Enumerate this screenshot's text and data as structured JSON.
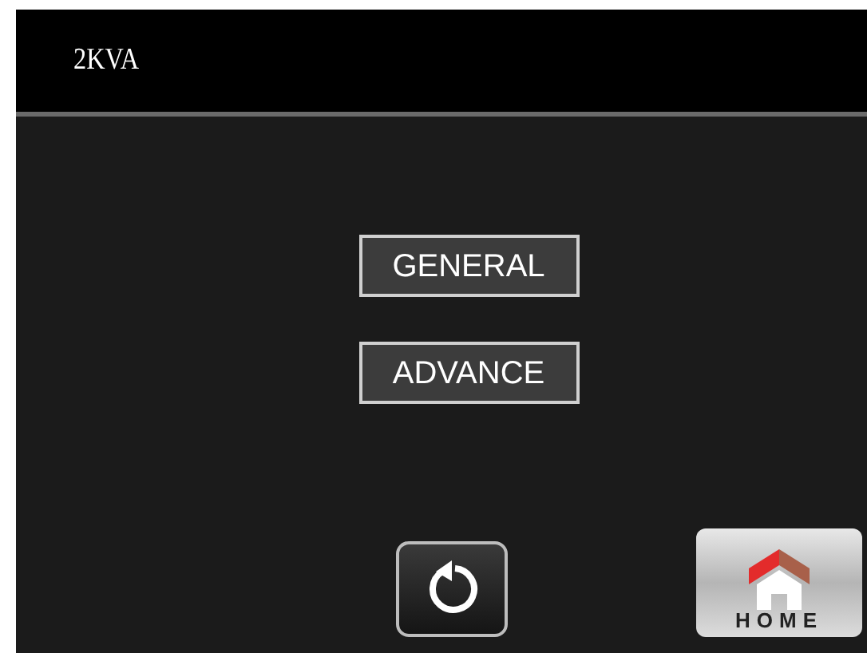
{
  "header": {
    "title": "2KVA"
  },
  "menu_buttons": [
    {
      "label": "GENERAL"
    },
    {
      "label": "ADVANCE"
    }
  ],
  "home_button": {
    "label": "HOME"
  }
}
